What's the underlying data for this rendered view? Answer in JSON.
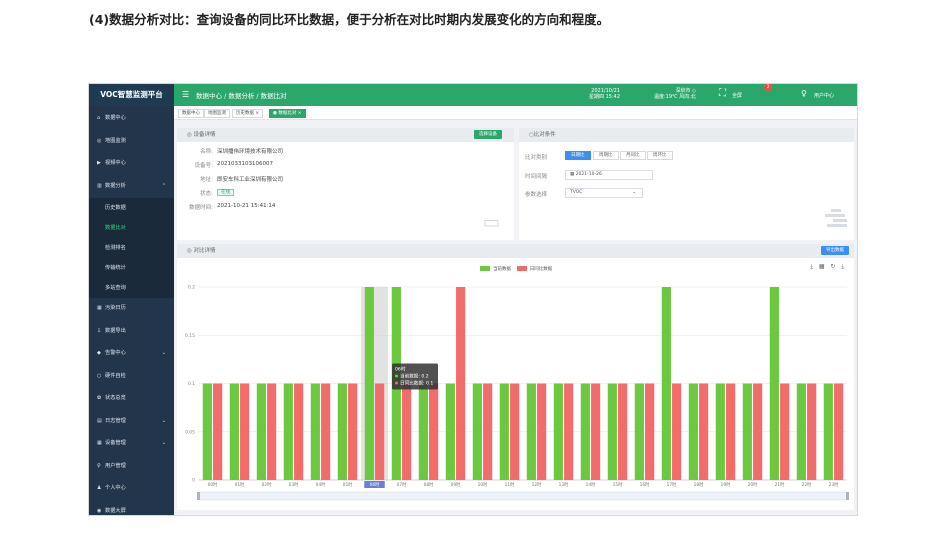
{
  "document": {
    "heading": "(4)数据分析对比：查询设备的同比环比数据，便于分析在对比时期内发展变化的方向和程度。"
  },
  "app": {
    "title": "VOC智慧监测平台",
    "breadcrumb": "数据中心 / 数据分析 / 数据比对",
    "datetime_line1": "2021/10/21",
    "datetime_line2": "星期四 15:42",
    "weather_line1": "深圳市 ◇",
    "weather_line2": "温度:19℃ 风向:北",
    "fullscreen_label": "全屏",
    "notification_count": "2",
    "user_label": "用户中心"
  },
  "colors": {
    "primary": "#2ca76c",
    "sidebar": "#23354a",
    "current_series": "#6cc93f",
    "yoy_series": "#f36c6c",
    "accent_blue": "#3b8ff0"
  },
  "sidebar": {
    "items": [
      {
        "icon": "home-icon",
        "glyph": "⌂",
        "label": "数据中心"
      },
      {
        "icon": "map-icon",
        "glyph": "◎",
        "label": "地图监测"
      },
      {
        "icon": "video-icon",
        "glyph": "▶",
        "label": "视频中心"
      },
      {
        "icon": "chart-icon",
        "glyph": "▥",
        "label": "数据分析",
        "expanded": true
      },
      {
        "label": "历史数据",
        "sub": true
      },
      {
        "label": "数据比对",
        "sub": true,
        "active": true
      },
      {
        "label": "检测排名",
        "sub": true
      },
      {
        "label": "传输统计",
        "sub": true
      },
      {
        "label": "多站查询",
        "sub": true
      },
      {
        "icon": "calendar-icon",
        "glyph": "▦",
        "label": "污染日历"
      },
      {
        "icon": "export-icon",
        "glyph": "⇩",
        "label": "数据导出"
      },
      {
        "icon": "alarm-icon",
        "glyph": "◆",
        "label": "告警中心",
        "has_arrow": true
      },
      {
        "icon": "hardware-icon",
        "glyph": "○",
        "label": "硬件自检"
      },
      {
        "icon": "status-icon",
        "glyph": "✿",
        "label": "状态总览"
      },
      {
        "icon": "log-icon",
        "glyph": "▤",
        "label": "日志管理",
        "has_arrow": true
      },
      {
        "icon": "device-icon",
        "glyph": "▦",
        "label": "设备管理",
        "has_arrow": true
      },
      {
        "icon": "users-icon",
        "glyph": "♀",
        "label": "用户管理"
      },
      {
        "icon": "person-icon",
        "glyph": "♟",
        "label": "个人中心"
      },
      {
        "icon": "screen-icon",
        "glyph": "◉",
        "label": "数据大屏"
      }
    ]
  },
  "tags": [
    {
      "label": "数据中心"
    },
    {
      "label": "地图监测"
    },
    {
      "label": "历史数据 ×"
    },
    {
      "label": "● 数据比对 ×",
      "active": true
    }
  ],
  "device_panel": {
    "title": "◎ 设备详情",
    "button": "选择设备",
    "rows": [
      {
        "label": "名称:",
        "value": "深圳播伟环境技术有限公司"
      },
      {
        "label": "设备号:",
        "value": "2021033103106007"
      },
      {
        "label": "地址:",
        "value": "即安车科工业深圳有限公司"
      },
      {
        "label": "状态:",
        "value": ""
      },
      {
        "label": "数据时间:",
        "value": "2021-10-21 15:41:14"
      }
    ],
    "status": "在线"
  },
  "compare_panel": {
    "title": "○比对条件",
    "type_label": "比对类别",
    "types": [
      "日期比",
      "周期比",
      "月同比",
      "周环比"
    ],
    "time_label": "时间间隔",
    "date_value": "2021-10-26",
    "param_label": "参数选择",
    "param_value": "TVOC"
  },
  "detail_panel": {
    "title": "◎ 对比详情",
    "export_button": "导出数据",
    "tools": "⤓ ▦ ↻ ⤓"
  },
  "chart_data": {
    "type": "bar",
    "legend": [
      "当前数据",
      "日同比数据"
    ],
    "categories": [
      "00时",
      "01时",
      "02时",
      "03时",
      "04时",
      "05时",
      "06时",
      "07时",
      "08时",
      "09时",
      "10时",
      "11时",
      "12时",
      "13时",
      "14时",
      "15时",
      "16时",
      "17时",
      "18时",
      "19时",
      "20时",
      "21时",
      "22时",
      "23时"
    ],
    "series": [
      {
        "name": "当前数据",
        "color": "#6cc93f",
        "values": [
          0.1,
          0.1,
          0.1,
          0.1,
          0.1,
          0.1,
          0.2,
          0.2,
          0.1,
          0.1,
          0.1,
          0.1,
          0.1,
          0.1,
          0.1,
          0.1,
          0.1,
          0.2,
          0.1,
          0.1,
          0.1,
          0.2,
          0.1,
          0.1
        ]
      },
      {
        "name": "日同比数据",
        "color": "#f36c6c",
        "values": [
          0.1,
          0.1,
          0.1,
          0.1,
          0.1,
          0.1,
          0.1,
          0.1,
          0.1,
          0.2,
          0.1,
          0.1,
          0.1,
          0.1,
          0.1,
          0.1,
          0.1,
          0.1,
          0.1,
          0.1,
          0.1,
          0.1,
          0.1,
          0.1
        ]
      }
    ],
    "yticks": [
      "0",
      "0.05",
      "0.1",
      "0.15",
      "0.2"
    ],
    "ylim": [
      0,
      0.2
    ],
    "grid": true,
    "highlight_category": "06时",
    "tooltip": {
      "title": "06时",
      "line1": "当前数据: 0.2",
      "line2": "日同比数据: 0.1"
    }
  }
}
